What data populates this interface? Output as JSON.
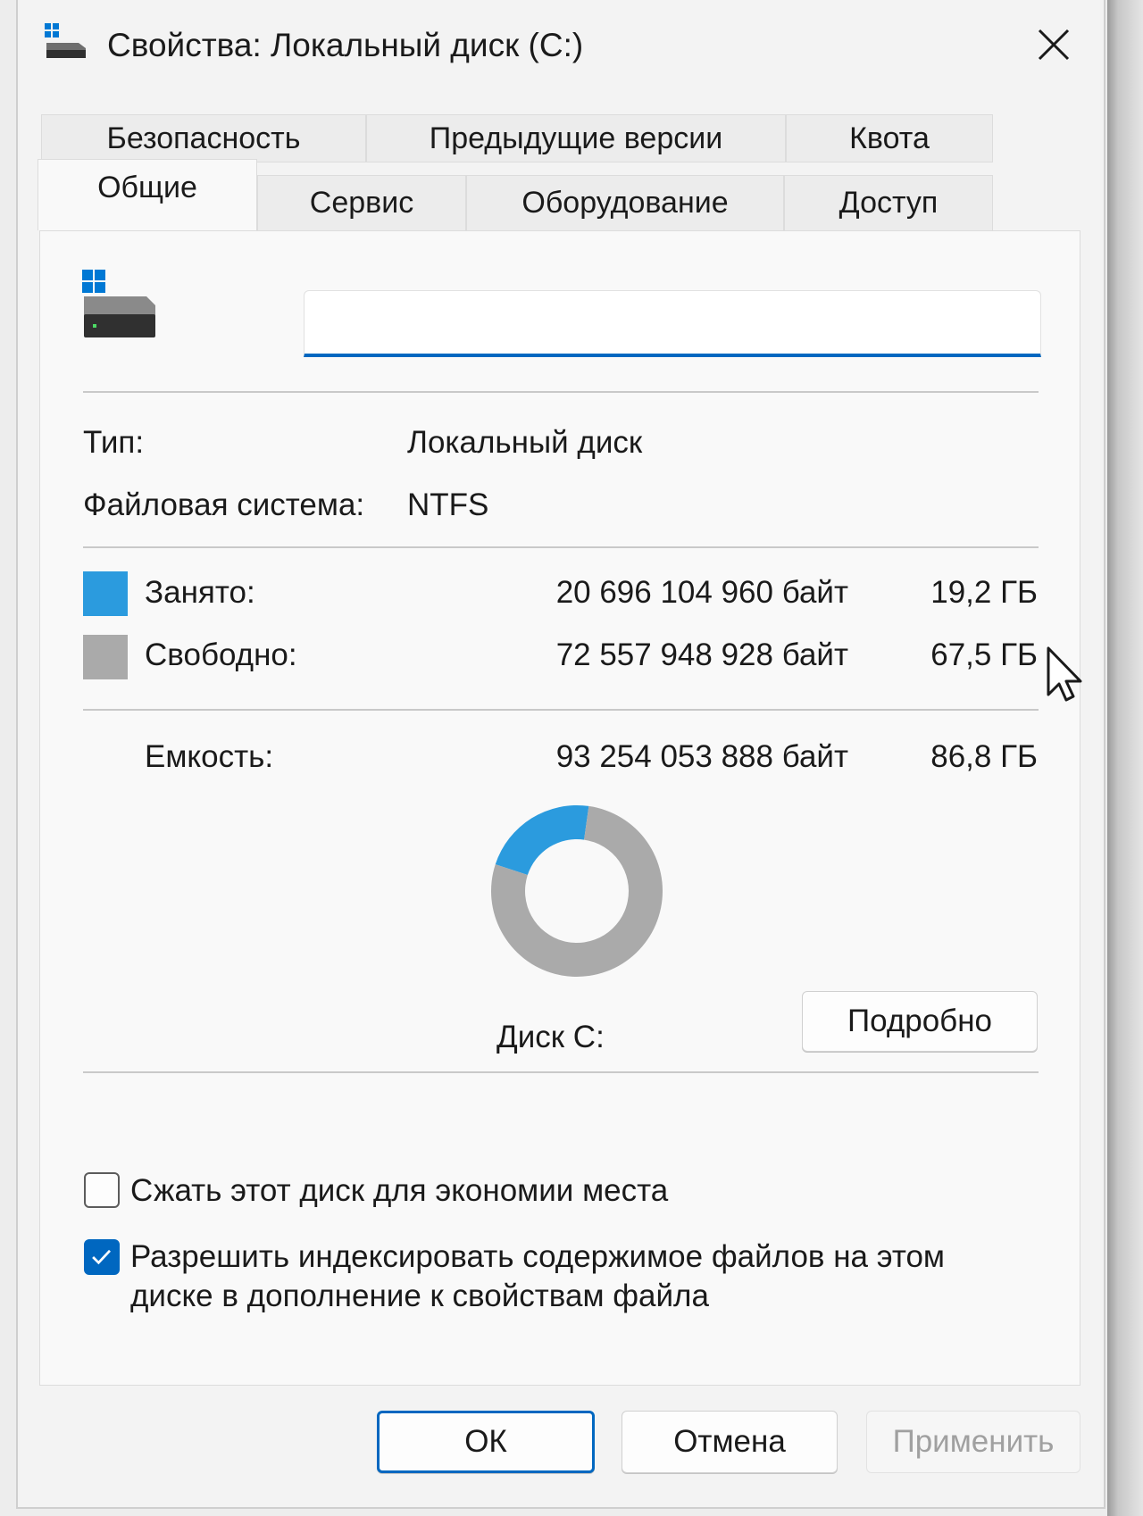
{
  "window": {
    "title": "Свойства: Локальный диск (C:)"
  },
  "tabs": {
    "back_row": [
      {
        "label": "Безопасность"
      },
      {
        "label": "Предыдущие версии"
      },
      {
        "label": "Квота"
      }
    ],
    "front_row": [
      {
        "label": "Общие",
        "active": true
      },
      {
        "label": "Сервис"
      },
      {
        "label": "Оборудование"
      },
      {
        "label": "Доступ"
      }
    ]
  },
  "general": {
    "drive_name_value": "",
    "type_label": "Тип:",
    "type_value": "Локальный диск",
    "fs_label": "Файловая система:",
    "fs_value": "NTFS",
    "used": {
      "label": "Занято:",
      "bytes": "20 696 104 960 байт",
      "size": "19,2 ГБ",
      "color": "#2b9bde"
    },
    "free": {
      "label": "Свободно:",
      "bytes": "72 557 948 928 байт",
      "size": "67,5 ГБ",
      "color": "#aaaaaa"
    },
    "capacity": {
      "label": "Емкость:",
      "bytes": "93 254 053 888 байт",
      "size": "86,8 ГБ"
    },
    "disk_label": "Диск C:",
    "details_button": "Подробно",
    "compress_checkbox": {
      "label": "Сжать этот диск для экономии места",
      "checked": false
    },
    "index_checkbox": {
      "label_line1": "Разрешить индексировать содержимое файлов на этом",
      "label_line2": "диске в дополнение к свойствам файла",
      "checked": true
    }
  },
  "chart_data": {
    "type": "pie",
    "categories": [
      "Занято",
      "Свободно"
    ],
    "values": [
      20696104960,
      72557948928
    ],
    "colors": [
      "#2b9bde",
      "#aaaaaa"
    ]
  },
  "footer": {
    "ok_button": "ОК",
    "cancel_button": "Отмена",
    "apply_button": "Применить"
  },
  "colors": {
    "accent": "#0067c0",
    "used": "#2b9bde",
    "free": "#aaaaaa"
  }
}
